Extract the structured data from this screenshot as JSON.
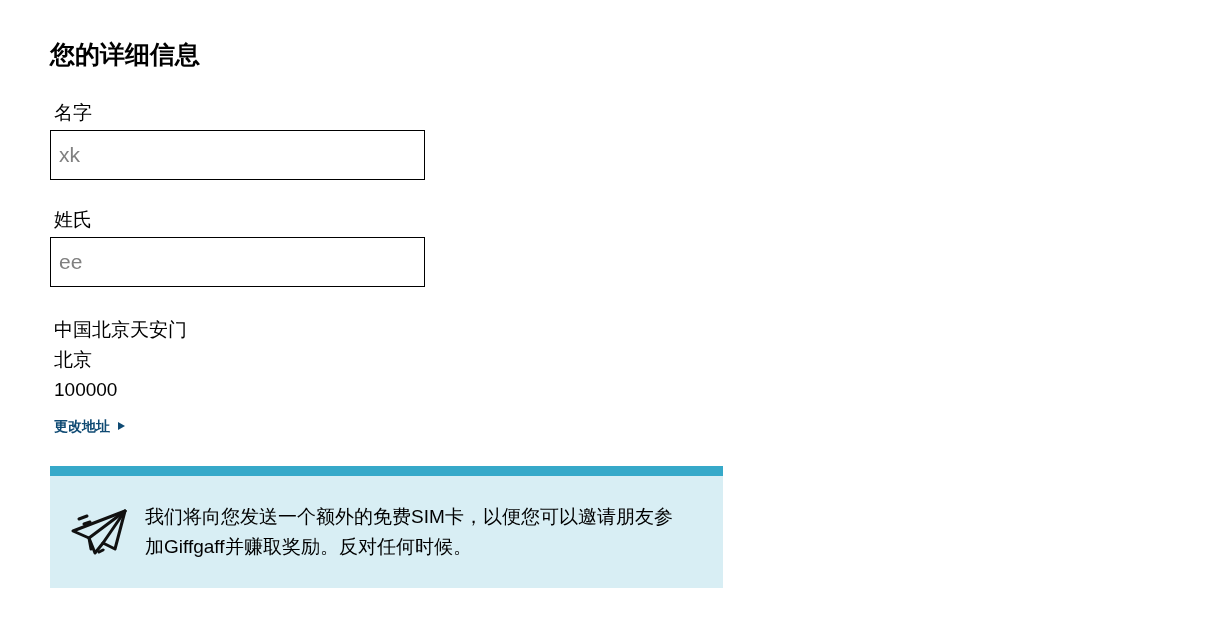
{
  "details": {
    "heading": "您的详细信息",
    "fields": [
      {
        "label": "名字",
        "value": "xk"
      },
      {
        "label": "姓氏",
        "value": "ee"
      }
    ],
    "address": {
      "lines": [
        "中国北京天安门",
        "北京",
        "100000"
      ]
    },
    "change_address_link": "更改地址"
  },
  "info_banner": {
    "text": "我们将向您发送一个额外的免费SIM卡，以便您可以邀请朋友参加Giffgaff并赚取奖励。反对任何时候。"
  }
}
